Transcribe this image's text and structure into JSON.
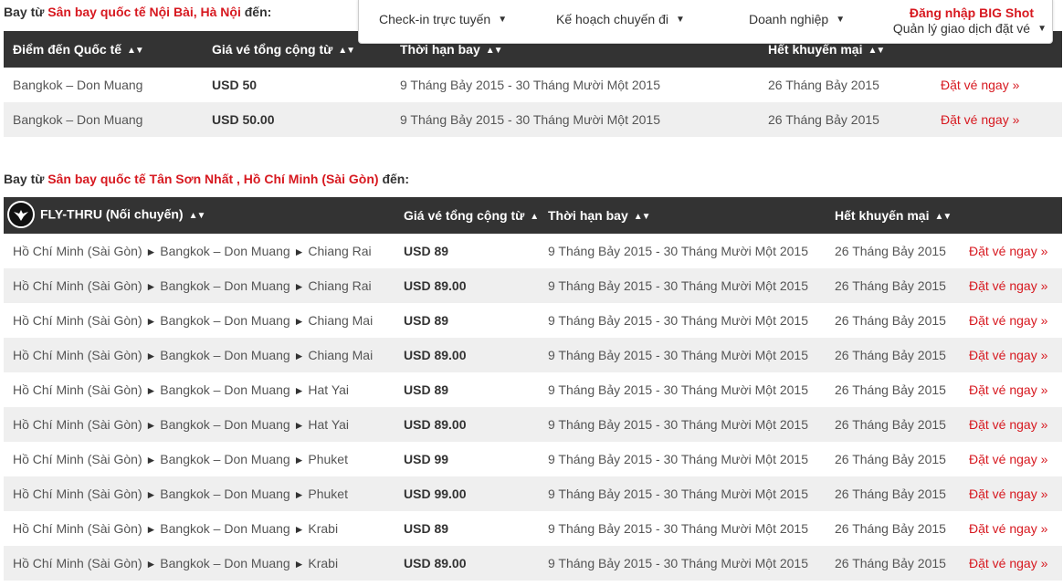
{
  "section1": {
    "prefix": "Bay từ",
    "airport": "Sân bay quốc tế Nội Bài, Hà Nội",
    "suffix": "đến:",
    "headers": {
      "destination": "Điểm đến Quốc tế",
      "price": "Giá vé tổng cộng từ",
      "period": "Thời hạn bay",
      "expiry": "Hết khuyến mại"
    },
    "rows": [
      {
        "destination": "Bangkok – Don Muang",
        "price": "USD 50",
        "period": "9 Tháng Bảy 2015 - 30 Tháng Mười Một 2015",
        "expiry": "26 Tháng Bảy 2015",
        "book": "Đặt vé ngay »"
      },
      {
        "destination": "Bangkok – Don Muang",
        "price": "USD 50.00",
        "period": "9 Tháng Bảy 2015 - 30 Tháng Mười Một 2015",
        "expiry": "26 Tháng Bảy 2015",
        "book": "Đặt vé ngay »"
      }
    ]
  },
  "section2": {
    "prefix": "Bay từ",
    "airport": "Sân bay quốc tế Tân Sơn Nhất , Hồ Chí Minh (Sài Gòn)",
    "suffix": "đến:",
    "headers": {
      "route": "FLY-THRU (Nối chuyến)",
      "price": "Giá vé tổng cộng từ",
      "period": "Thời hạn bay",
      "expiry": "Hết khuyến mại"
    },
    "rows": [
      {
        "origin": "Hồ Chí Minh (Sài Gòn)",
        "via": "Bangkok – Don Muang",
        "dest": "Chiang Rai",
        "price": "USD 89",
        "period": "9 Tháng Bảy 2015 - 30 Tháng Mười Một 2015",
        "expiry": "26 Tháng Bảy 2015",
        "book": "Đặt vé ngay »"
      },
      {
        "origin": "Hồ Chí Minh (Sài Gòn)",
        "via": "Bangkok – Don Muang",
        "dest": "Chiang Rai",
        "price": "USD 89.00",
        "period": "9 Tháng Bảy 2015 - 30 Tháng Mười Một 2015",
        "expiry": "26 Tháng Bảy 2015",
        "book": "Đặt vé ngay »"
      },
      {
        "origin": "Hồ Chí Minh (Sài Gòn)",
        "via": "Bangkok – Don Muang",
        "dest": "Chiang Mai",
        "price": "USD 89",
        "period": "9 Tháng Bảy 2015 - 30 Tháng Mười Một 2015",
        "expiry": "26 Tháng Bảy 2015",
        "book": "Đặt vé ngay »"
      },
      {
        "origin": "Hồ Chí Minh (Sài Gòn)",
        "via": "Bangkok – Don Muang",
        "dest": "Chiang Mai",
        "price": "USD 89.00",
        "period": "9 Tháng Bảy 2015 - 30 Tháng Mười Một 2015",
        "expiry": "26 Tháng Bảy 2015",
        "book": "Đặt vé ngay »"
      },
      {
        "origin": "Hồ Chí Minh (Sài Gòn)",
        "via": "Bangkok – Don Muang",
        "dest": "Hat Yai",
        "price": "USD 89",
        "period": "9 Tháng Bảy 2015 - 30 Tháng Mười Một 2015",
        "expiry": "26 Tháng Bảy 2015",
        "book": "Đặt vé ngay »"
      },
      {
        "origin": "Hồ Chí Minh (Sài Gòn)",
        "via": "Bangkok – Don Muang",
        "dest": "Hat Yai",
        "price": "USD 89.00",
        "period": "9 Tháng Bảy 2015 - 30 Tháng Mười Một 2015",
        "expiry": "26 Tháng Bảy 2015",
        "book": "Đặt vé ngay »"
      },
      {
        "origin": "Hồ Chí Minh (Sài Gòn)",
        "via": "Bangkok – Don Muang",
        "dest": "Phuket",
        "price": "USD 99",
        "period": "9 Tháng Bảy 2015 - 30 Tháng Mười Một 2015",
        "expiry": "26 Tháng Bảy 2015",
        "book": "Đặt vé ngay »"
      },
      {
        "origin": "Hồ Chí Minh (Sài Gòn)",
        "via": "Bangkok – Don Muang",
        "dest": "Phuket",
        "price": "USD 99.00",
        "period": "9 Tháng Bảy 2015 - 30 Tháng Mười Một 2015",
        "expiry": "26 Tháng Bảy 2015",
        "book": "Đặt vé ngay »"
      },
      {
        "origin": "Hồ Chí Minh (Sài Gòn)",
        "via": "Bangkok – Don Muang",
        "dest": "Krabi",
        "price": "USD 89",
        "period": "9 Tháng Bảy 2015 - 30 Tháng Mười Một 2015",
        "expiry": "26 Tháng Bảy 2015",
        "book": "Đặt vé ngay »"
      },
      {
        "origin": "Hồ Chí Minh (Sài Gòn)",
        "via": "Bangkok – Don Muang",
        "dest": "Krabi",
        "price": "USD 89.00",
        "period": "9 Tháng Bảy 2015 - 30 Tháng Mười Một 2015",
        "expiry": "26 Tháng Bảy 2015",
        "book": "Đặt vé ngay »"
      }
    ]
  },
  "nav": {
    "checkin": "Check-in trực tuyến",
    "plan": "Kế hoạch chuyến đi",
    "business": "Doanh nghiệp",
    "login": "Đăng nhập BIG Shot",
    "manage": "Quản lý giao dịch đặt vé"
  },
  "icons": {
    "sort": "sort-up-down-icon",
    "caret": "caret-down-icon",
    "route_arrow": "triangle-right-icon",
    "fly_thru": "fly-thru-logo"
  },
  "colors": {
    "accent_red": "#d71920",
    "header_bg": "#333333",
    "row_alt": "#efefef"
  }
}
